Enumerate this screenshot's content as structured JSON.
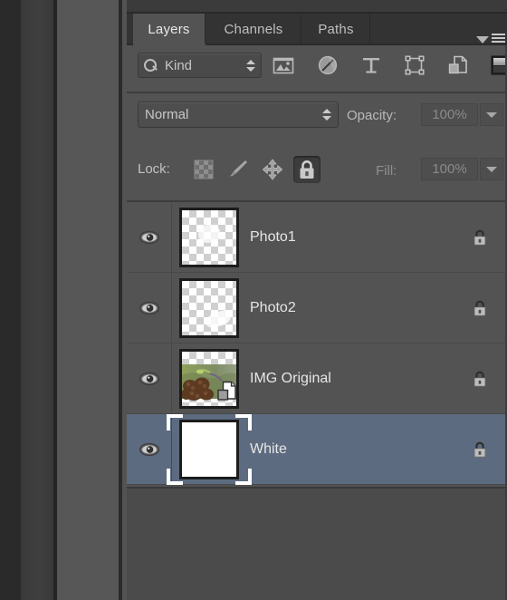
{
  "panel": {
    "tabs": [
      {
        "label": "Layers",
        "active": true,
        "name": "tab-layers"
      },
      {
        "label": "Channels",
        "active": false,
        "name": "tab-channels"
      },
      {
        "label": "Paths",
        "active": false,
        "name": "tab-paths"
      }
    ],
    "menu_icon": "panel-menu-icon"
  },
  "filter": {
    "kind_label": "Kind",
    "search_icon": "search-icon",
    "stepper_icon": "updown-stepper-icon",
    "icons": [
      {
        "name": "filter-pixel-layers-icon"
      },
      {
        "name": "filter-adjustment-layers-icon"
      },
      {
        "name": "filter-type-layers-icon"
      },
      {
        "name": "filter-shape-layers-icon"
      },
      {
        "name": "filter-smart-object-layers-icon"
      },
      {
        "name": "filter-toggle-icon"
      }
    ]
  },
  "blend": {
    "mode": "Normal",
    "opacity_label": "Opacity:",
    "opacity_value": "100%",
    "dropdown_icon": "chevron-down-icon"
  },
  "lock": {
    "label": "Lock:",
    "buttons": [
      {
        "name": "lock-transparent-pixels-button",
        "active": false
      },
      {
        "name": "lock-image-pixels-button",
        "active": false
      },
      {
        "name": "lock-position-button",
        "active": false
      },
      {
        "name": "lock-all-button",
        "active": true
      }
    ],
    "fill_label": "Fill:",
    "fill_value": "100%"
  },
  "layers": [
    {
      "name": "Photo1",
      "visible": true,
      "locked": true,
      "selected": false,
      "thumb": "checker",
      "badge": false
    },
    {
      "name": "Photo2",
      "visible": true,
      "locked": true,
      "selected": false,
      "thumb": "checker",
      "badge": false
    },
    {
      "name": "IMG Original",
      "visible": true,
      "locked": true,
      "selected": false,
      "thumb": "image",
      "badge": true
    },
    {
      "name": "White",
      "visible": true,
      "locked": true,
      "selected": true,
      "thumb": "white",
      "badge": false
    }
  ],
  "colors": {
    "panel_bg": "#535353",
    "tab_bar_bg": "#333333",
    "selection": "#5d6b80",
    "text": "#e6e6e6",
    "muted_text": "#8a8a8a"
  }
}
